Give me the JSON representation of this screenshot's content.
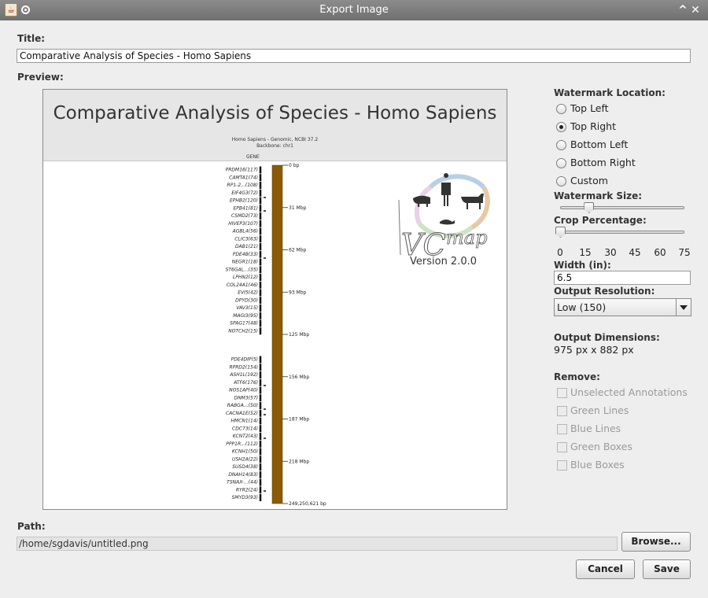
{
  "window": {
    "title": "Export Image"
  },
  "labels": {
    "title": "Title:",
    "preview": "Preview:",
    "path": "Path:",
    "watermark_location": "Watermark Location:",
    "watermark_size": "Watermark Size:",
    "crop_percentage": "Crop Percentage:",
    "width": "Width (in):",
    "output_resolution": "Output Resolution:",
    "output_dimensions": "Output Dimensions:",
    "remove": "Remove:"
  },
  "title_field": {
    "value": "Comparative Analysis of Species - Homo Sapiens"
  },
  "preview": {
    "title": "Comparative Analysis of Species - Homo Sapiens",
    "subtitle_1": "Homo Sapiens - Genomic, NCBI 37.2",
    "subtitle_2": "Backbone: chr1",
    "gene_header": "GENE",
    "genes_top": [
      "PRDM16(117)",
      "CAMTA1(74)",
      "RP1-2...(108)",
      "EIF4G3(72)",
      "EPHB2(120)",
      "EPB41(81)",
      "CSMD2(73)",
      "HIVEP3(107)",
      "AGBL4(56)",
      "CLIC3(63)",
      "DAB1(21)",
      "PDE4B(33)",
      "NEGR1(18)",
      "ST6GAL...(35)",
      "LPHN2(12)",
      "COL24A1(46)",
      "EVI5(42)",
      "DPYD(30)",
      "VAV3(15)",
      "MAGI3(95)",
      "SPAG17(48)",
      "NOTCH2(15)"
    ],
    "genes_bottom": [
      "PDE4DIP(5)",
      "RPRD2(154)",
      "ASH1L(192)",
      "ATF6(176)",
      "NOS1AP(40)",
      "DNM3(57)",
      "RABGA...(50)",
      "CACNA1E(52)",
      "HMCN1(14)",
      "CDC73(14)",
      "KCNT2(43)",
      "PPP1R...(112)",
      "KCNH1(50)",
      "USH2A(22)",
      "SUSD4(38)",
      "DNAH14(83)",
      "TSNAX-...(44)",
      "RYR2(24)",
      "SMYD3(93)"
    ],
    "ticks": [
      "0 bp",
      "31 Mbp",
      "62 Mbp",
      "93 Mbp",
      "125 Mbp",
      "156 Mbp",
      "187 Mbp",
      "218 Mbp",
      "249,250,621 bp"
    ],
    "watermark_version": "Version 2.0.0",
    "backbone_color": "#8b5a06"
  },
  "watermark_location": {
    "options": [
      "Top Left",
      "Top Right",
      "Bottom Left",
      "Bottom Right",
      "Custom"
    ],
    "selected": "Top Right"
  },
  "watermark_size": {
    "level": 0.23
  },
  "crop": {
    "ticks": [
      "0",
      "15",
      "30",
      "45",
      "60",
      "75"
    ],
    "value": 0
  },
  "width_field": {
    "value": "6.5"
  },
  "resolution": {
    "selected": "Low (150)"
  },
  "dimensions": {
    "value": "975 px x 882 px"
  },
  "remove": {
    "options": [
      "Unselected Annotations",
      "Green Lines",
      "Blue Lines",
      "Green Boxes",
      "Blue Boxes"
    ]
  },
  "path_field": {
    "value": "/home/sgdavis/untitled.png"
  },
  "buttons": {
    "browse": "Browse...",
    "cancel": "Cancel",
    "save": "Save"
  }
}
